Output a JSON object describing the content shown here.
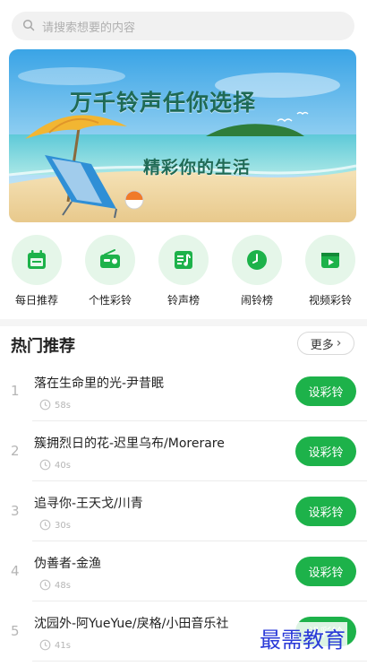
{
  "search": {
    "placeholder": "请搜索想要的内容",
    "icon": "search-icon"
  },
  "banner": {
    "line1": "万千铃声任你选择",
    "line2": "精彩你的生活"
  },
  "categories": [
    {
      "label": "每日推荐",
      "icon": "calendar-icon"
    },
    {
      "label": "个性彩铃",
      "icon": "radio-icon"
    },
    {
      "label": "铃声榜",
      "icon": "music-list-icon"
    },
    {
      "label": "闹铃榜",
      "icon": "clock-icon"
    },
    {
      "label": "视频彩铃",
      "icon": "video-icon"
    }
  ],
  "section": {
    "title": "热门推荐",
    "more": "更多"
  },
  "songs": [
    {
      "rank": "1",
      "title": "落在生命里的光-尹昔眠",
      "duration": "58s",
      "button": "设彩铃"
    },
    {
      "rank": "2",
      "title": "簇拥烈日的花-迟里乌布/Morerare",
      "duration": "40s",
      "button": "设彩铃"
    },
    {
      "rank": "3",
      "title": "追寻你-王天戈/川青",
      "duration": "30s",
      "button": "设彩铃"
    },
    {
      "rank": "4",
      "title": "伪善者-金渔",
      "duration": "48s",
      "button": "设彩铃"
    },
    {
      "rank": "5",
      "title": "沈园外-阿YueYue/戾格/小田音乐社",
      "duration": "41s",
      "button": "设彩铃"
    }
  ],
  "watermark": "最需教育",
  "colors": {
    "accent": "#1db24a",
    "icon_bg": "#e5f6e9",
    "banner_text": "#1f6a55"
  }
}
